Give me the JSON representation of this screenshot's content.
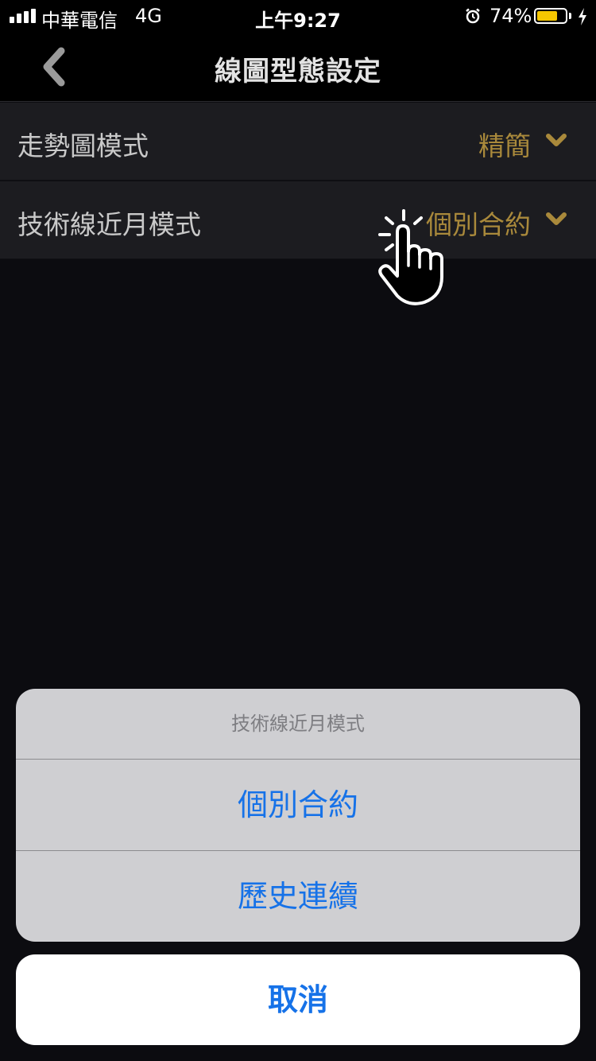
{
  "status_bar": {
    "carrier": "中華電信",
    "network": "4G",
    "time": "上午9:27",
    "battery_percent": "74%",
    "battery_level": 0.74
  },
  "nav": {
    "title": "線圖型態設定",
    "back_icon": "chevron-left-icon"
  },
  "settings": [
    {
      "label": "走勢圖模式",
      "value": "精簡"
    },
    {
      "label": "技術線近月模式",
      "value": "個別合約"
    }
  ],
  "action_sheet": {
    "title": "技術線近月模式",
    "options": [
      "個別合約",
      "歷史連續"
    ],
    "cancel": "取消"
  },
  "colors": {
    "accent_gold": "#a9893b",
    "ios_blue": "#1672e8",
    "battery": "#f6c700"
  }
}
